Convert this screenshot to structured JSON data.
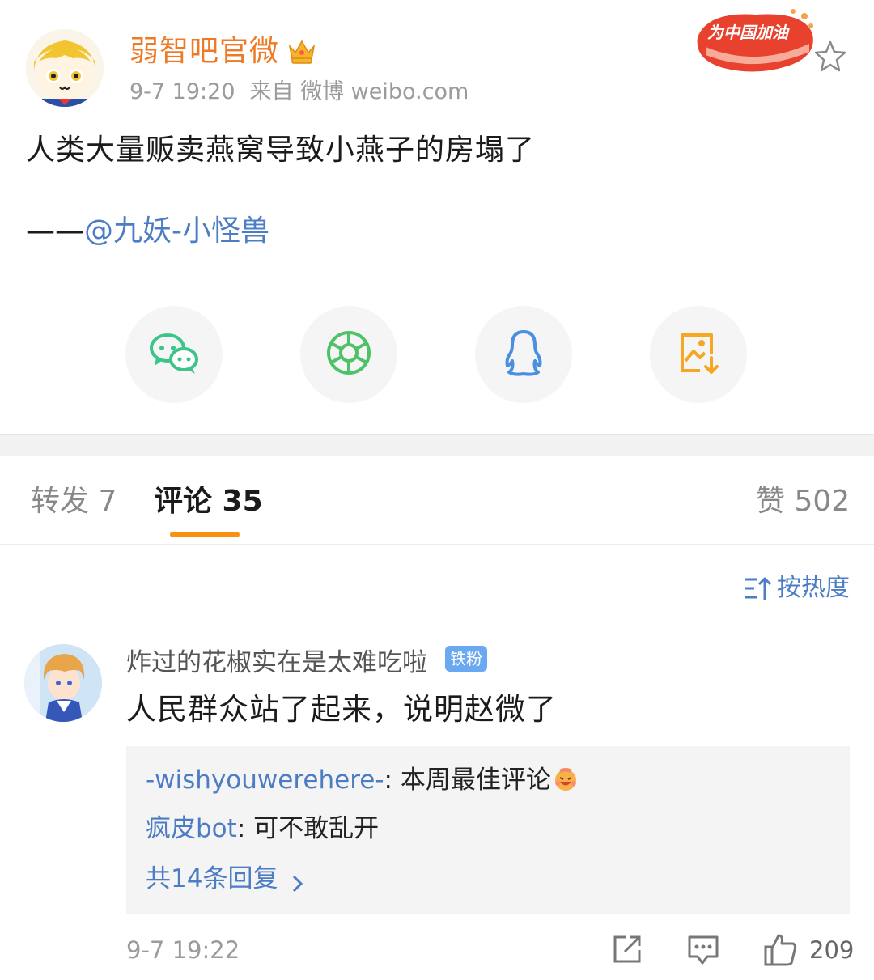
{
  "post": {
    "author": "弱智吧官微",
    "time": "9-7 19:20",
    "source": "来自 微博 weibo.com",
    "badge_text": "为中国加油",
    "text": "人类大量贩卖燕窝导致小燕子的房塌了",
    "sign_prefix": "——",
    "sign_mention": "@九妖-小怪兽"
  },
  "share": {
    "items": [
      "wechat-icon",
      "moments-icon",
      "qq-icon",
      "save-image-icon"
    ]
  },
  "tabs": {
    "repost": "转发 7",
    "comment": "评论 35",
    "like": "赞 502"
  },
  "sort": {
    "label": "按热度"
  },
  "comment": {
    "user": "炸过的花椒实在是太难吃啦",
    "fan_badge": "铁粉",
    "text": "人民群众站了起来，说明赵微了",
    "replies": [
      {
        "user": "-wishyouwerehere-",
        "sep": ": ",
        "text": "本周最佳评论"
      },
      {
        "user": "疯皮bot",
        "sep": ": ",
        "text": "可不敢乱开"
      }
    ],
    "more_replies": "共14条回复",
    "time": "9-7 19:22",
    "likes": "209"
  },
  "colors": {
    "author": "#ee7a25",
    "link": "#4c7cc4",
    "tab_indicator": "#fa8f10",
    "wechat": "#3cc58a",
    "moments": "#4ec266",
    "qq": "#4a8fe0",
    "save": "#f5a623"
  }
}
